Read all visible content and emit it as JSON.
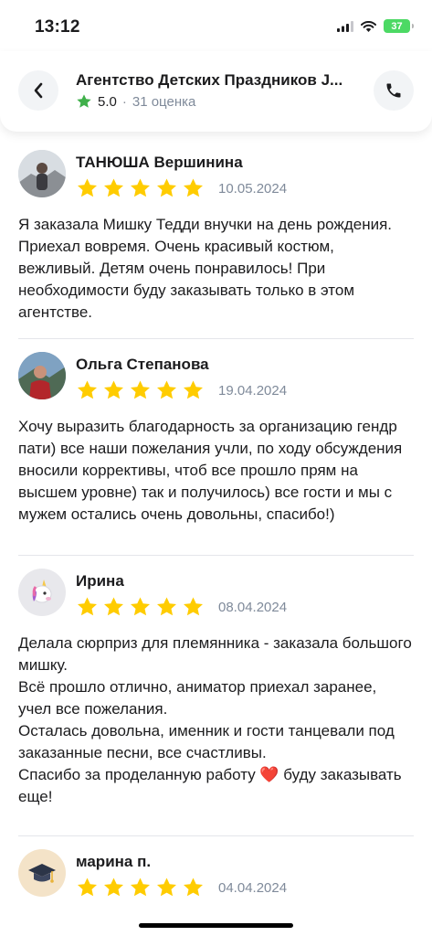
{
  "status": {
    "time": "13:12",
    "battery": "37"
  },
  "header": {
    "title": "Агентство Детских Праздников J...",
    "rating": "5.0",
    "separator": "·",
    "rating_count": "31 оценка"
  },
  "reviews": [
    {
      "author": "ТАНЮША Вершинина",
      "stars": 5,
      "date": "10.05.2024",
      "text": "Я заказала Мишку Тедди внучки на день рождения. Приехал вовремя. Очень красивый костюм, вежливый. Детям очень понравилось! При необходимости буду заказывать только в этом агентстве."
    },
    {
      "author": "Ольга Степанова",
      "stars": 5,
      "date": "19.04.2024",
      "text": "Хочу выразить благодарность за организацию гендр пати) все наши пожелания учли, по ходу обсуждения вносили коррективы, чтоб все прошло прям на высшем уровне) так и получилось) все гости и мы с мужем остались очень довольны, спасибо!)"
    },
    {
      "author": "Ирина",
      "stars": 5,
      "date": "08.04.2024",
      "text": "Делала сюрприз для племянника - заказала большого мишку.\nВсё прошло отлично, аниматор приехал заранее, учел все пожелания.\nОсталась довольна, именник и гости танцевали под заказанные песни, все счастливы.\nСпасибо за проделанную работу ❤️ буду заказывать еще!"
    },
    {
      "author": "марина п.",
      "stars": 5,
      "date": "04.04.2024",
      "text": ""
    }
  ],
  "colors": {
    "star": "#ffcc00",
    "header_star": "#3fb04a",
    "meta": "#7f8a9a"
  }
}
